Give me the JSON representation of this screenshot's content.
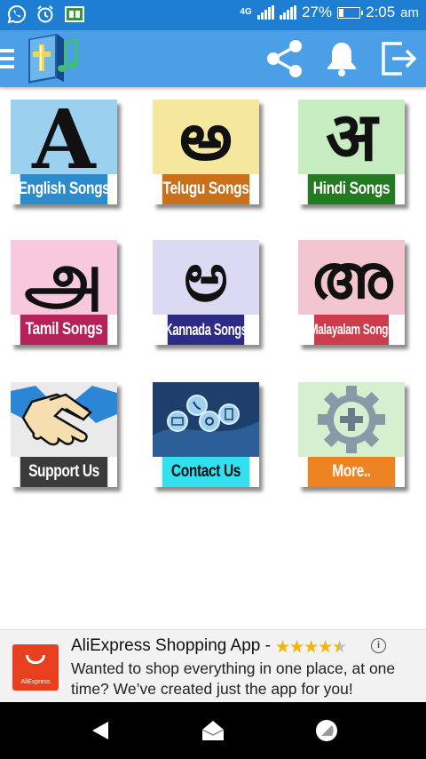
{
  "status_bar": {
    "network_type": "4G",
    "battery_percent": "27%",
    "battery_level": 0.27,
    "time": "2:05",
    "ampm": "am",
    "icons": [
      "whatsapp-call-icon",
      "alarm-icon",
      "notification-app-icon"
    ]
  },
  "app_bar": {
    "icons": [
      "menu-icon",
      "app-logo-icon",
      "share-icon",
      "bell-icon",
      "exit-icon"
    ]
  },
  "tiles": [
    {
      "id": "english",
      "glyph": "A",
      "label": "English Songs",
      "top_color": "#9bd1ee",
      "label_color": "#2b8ccd"
    },
    {
      "id": "telugu",
      "glyph": "అ",
      "label": "Telugu Songs",
      "top_color": "#f5e79e",
      "label_color": "#c8701a"
    },
    {
      "id": "hindi",
      "glyph": "अ",
      "label": "Hindi Songs",
      "top_color": "#c8ecc2",
      "label_color": "#237a21"
    },
    {
      "id": "tamil",
      "glyph": "அ",
      "label": "Tamil Songs",
      "top_color": "#f8c9dc",
      "label_color": "#b42259"
    },
    {
      "id": "kannada",
      "glyph": "ಅ",
      "label": "Kannada Songs",
      "top_color": "#dcdaf2",
      "label_color": "#2e2b88"
    },
    {
      "id": "malayalam",
      "glyph": "അ",
      "label": "Malayalam Songs",
      "top_color": "#f3c6cf",
      "label_color": "#cc3c4b"
    },
    {
      "id": "support",
      "glyph": "",
      "label": "Support Us",
      "top_color": "#eaeaea",
      "label_color": "#3b3b3b"
    },
    {
      "id": "contact",
      "glyph": "",
      "label": "Contact Us",
      "top_color": "#20487a",
      "label_color": "#33e0ef"
    },
    {
      "id": "more",
      "glyph": "",
      "label": "More..",
      "top_color": "#d6efcf",
      "label_color": "#ee8324"
    }
  ],
  "ad": {
    "logo_text": "AliExpress",
    "title": "AliExpress Shopping App -",
    "rating_stars": 4.5,
    "stars_text": "★★★★★",
    "info_label": "i",
    "body": "Wanted to shop everything in one place, at one time? We’ve created just the app for you!"
  },
  "nav_bar": {
    "icons": [
      "back-icon",
      "home-icon",
      "recents-icon"
    ]
  }
}
